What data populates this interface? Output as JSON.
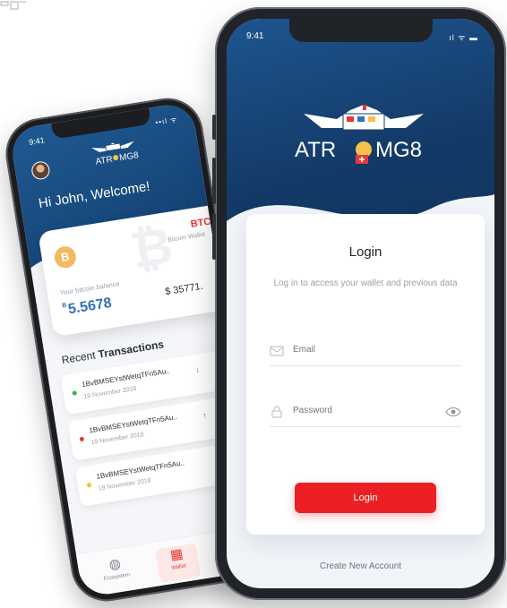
{
  "colors": {
    "navy": "#133a67",
    "blue": "#1e5590",
    "accent_red": "#ec2024",
    "balance_blue": "#2f72b8",
    "green": "#2fb34a",
    "yellow": "#f2c01e"
  },
  "back_phone": {
    "status_time": "9:41",
    "status_icons": "••ıl ᯤ",
    "welcome_text": "Hi John, Welcome!",
    "balance_card": {
      "coin_symbol": "B",
      "currency_code": "BTC",
      "wallet_label": "Bitcoin Wallet",
      "balance_label": "Your bitcoin balance",
      "balance_prefix": "B",
      "balance_value": "5.5678",
      "usd_value": "$ 35771."
    },
    "recent": {
      "prefix": "Recent ",
      "bold": "Transactions"
    },
    "transactions": [
      {
        "hash": "1BvBMSEYstWetqTFn5Au..",
        "date": "19 November 2018",
        "status_color": "#2fb34a",
        "direction_icon": "arrow-down-icon",
        "arrow": "↓",
        "arrow_color": "#2fb34a"
      },
      {
        "hash": "1BvBMSEYstWetqTFn5Au..",
        "date": "19 November 2018",
        "status_color": "#e53935",
        "direction_icon": "arrow-up-icon",
        "arrow": "↑",
        "arrow_color": "#e53935"
      },
      {
        "hash": "1BvBMSEYstWetqTFn5Au..",
        "date": "19 November 2018",
        "status_color": "#f2c01e",
        "direction_icon": "",
        "arrow": "",
        "arrow_color": "#9aa2ad"
      }
    ],
    "tabs": [
      {
        "label": "Ecosystem",
        "icon": "globe-icon",
        "glyph": "◍"
      },
      {
        "label": "Wallet",
        "icon": "grid-icon",
        "glyph": "▦"
      }
    ]
  },
  "front_phone": {
    "status_time": "9:41",
    "status_icons": "ıl ᯤ ▬",
    "brand_text_left": "ATR",
    "brand_text_right": "MG8",
    "login": {
      "title": "Login",
      "subtitle": "Log in to access your wallet and previous data",
      "email_placeholder": "Email",
      "password_placeholder": "Password",
      "button_label": "Login"
    },
    "create_account_label": "Create New Account"
  }
}
